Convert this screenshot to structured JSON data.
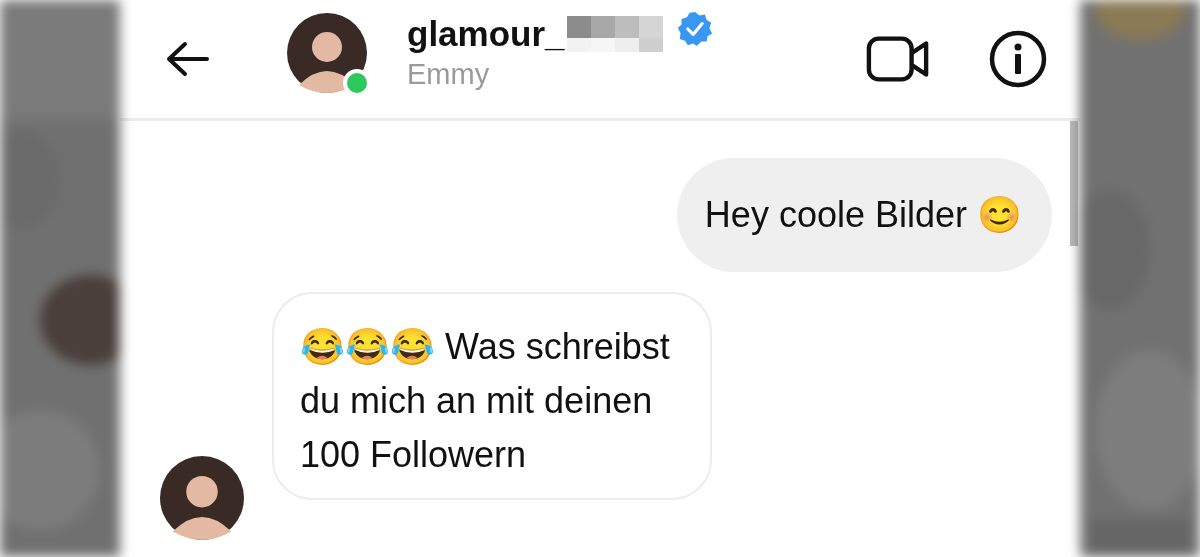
{
  "header": {
    "username": "glamour_",
    "username_redacted": true,
    "verified": true,
    "display_name": "Emmy",
    "online": true
  },
  "messages": [
    {
      "kind": "sent",
      "text": "Hey coole Bilder 😊"
    },
    {
      "kind": "received",
      "text": "😂😂😂 Was schreibst du mich an mit deinen 100 Followern",
      "avatar": true
    }
  ]
}
